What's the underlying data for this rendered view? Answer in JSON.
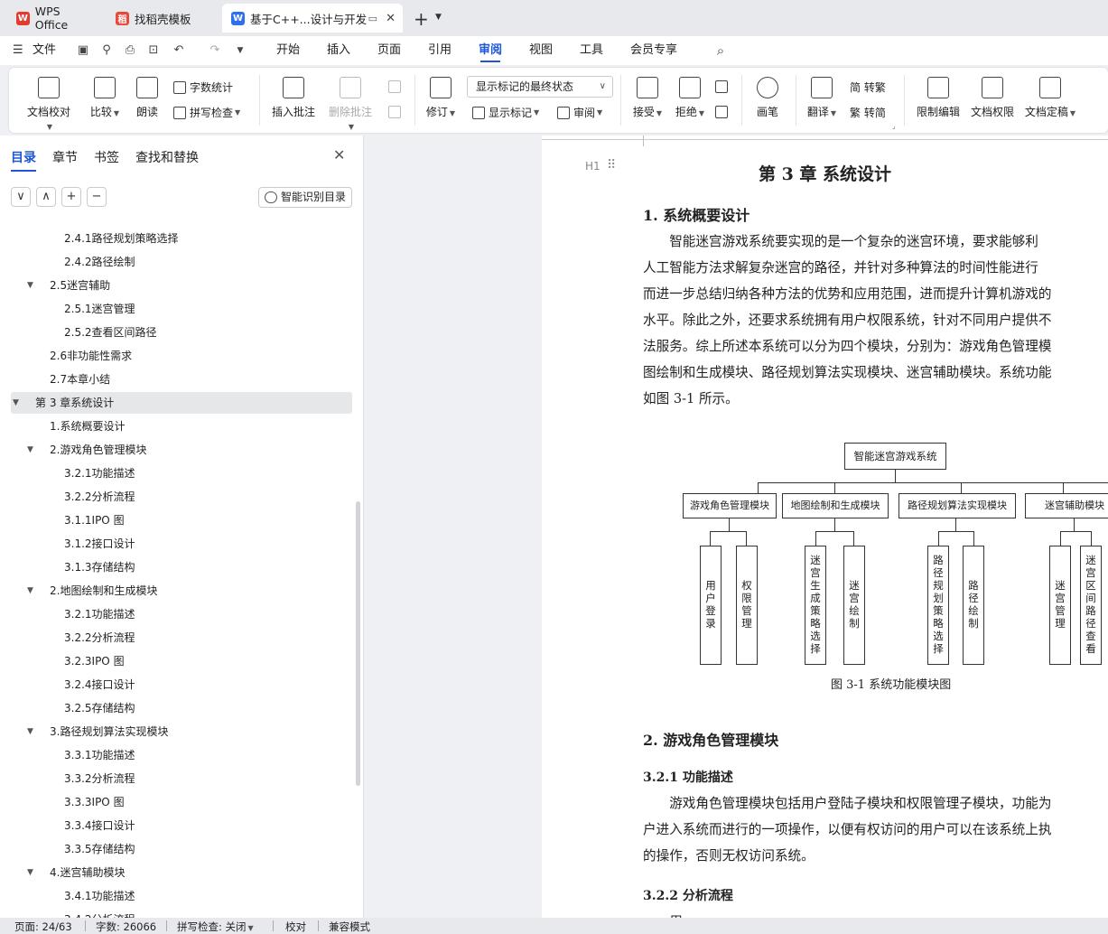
{
  "tabs": [
    {
      "label": "WPS Office",
      "icon": "wps-logo-icon",
      "color": "#e33b2e"
    },
    {
      "label": "找稻壳模板",
      "icon": "docer-icon",
      "color": "#e64a3c"
    },
    {
      "label": "基于C++...设计与开发",
      "icon": "writer-doc-icon",
      "color": "#2f6fed"
    }
  ],
  "new_tab": "+",
  "menu": {
    "file": "文件",
    "items": [
      "开始",
      "插入",
      "页面",
      "引用",
      "审阅",
      "视图",
      "工具",
      "会员专享"
    ],
    "active": "审阅"
  },
  "ribbon": {
    "doc_check": "文档校对",
    "compare": "比较",
    "read_aloud": "朗读",
    "word_count": "字数统计",
    "spell_check": "拼写检查",
    "insert_comment": "插入批注",
    "delete_comment": "删除批注",
    "revise": "修订",
    "markup_select": "显示标记的最终状态",
    "show_markup": "显示标记",
    "review": "审阅",
    "accept": "接受",
    "reject": "拒绝",
    "pen": "画笔",
    "translate": "翻译",
    "to_traditional": "简 转繁",
    "to_simplified": "繁 转简",
    "restrict_edit": "限制编辑",
    "doc_permission": "文档权限",
    "finalize": "文档定稿"
  },
  "panel": {
    "tabs": [
      "目录",
      "章节",
      "书签",
      "查找和替换"
    ],
    "active_tab": "目录",
    "smart_toc": "智能识别目录",
    "toc": [
      {
        "label": "2.4.1路径规划策略选择",
        "level": 3,
        "arrow": ""
      },
      {
        "label": "2.4.2路径绘制",
        "level": 3,
        "arrow": ""
      },
      {
        "label": "2.5迷宫辅助",
        "level": 2,
        "arrow": "▼"
      },
      {
        "label": "2.5.1迷宫管理",
        "level": 3,
        "arrow": ""
      },
      {
        "label": "2.5.2查看区间路径",
        "level": 3,
        "arrow": ""
      },
      {
        "label": "2.6非功能性需求",
        "level": 2,
        "arrow": ""
      },
      {
        "label": "2.7本章小结",
        "level": 2,
        "arrow": ""
      },
      {
        "label": "第 3 章系统设计",
        "level": 1,
        "arrow": "▼",
        "selected": true
      },
      {
        "label": "1.系统概要设计",
        "level": 2,
        "arrow": ""
      },
      {
        "label": "2.游戏角色管理模块",
        "level": 2,
        "arrow": "▼"
      },
      {
        "label": "3.2.1功能描述",
        "level": 3,
        "arrow": ""
      },
      {
        "label": "3.2.2分析流程",
        "level": 3,
        "arrow": ""
      },
      {
        "label": "3.1.1IPO 图",
        "level": 3,
        "arrow": ""
      },
      {
        "label": "3.1.2接口设计",
        "level": 3,
        "arrow": ""
      },
      {
        "label": "3.1.3存储结构",
        "level": 3,
        "arrow": ""
      },
      {
        "label": "2.地图绘制和生成模块",
        "level": 2,
        "arrow": "▼"
      },
      {
        "label": "3.2.1功能描述",
        "level": 3,
        "arrow": ""
      },
      {
        "label": "3.2.2分析流程",
        "level": 3,
        "arrow": ""
      },
      {
        "label": "3.2.3IPO 图",
        "level": 3,
        "arrow": ""
      },
      {
        "label": "3.2.4接口设计",
        "level": 3,
        "arrow": ""
      },
      {
        "label": "3.2.5存储结构",
        "level": 3,
        "arrow": ""
      },
      {
        "label": "3.路径规划算法实现模块",
        "level": 2,
        "arrow": "▼"
      },
      {
        "label": "3.3.1功能描述",
        "level": 3,
        "arrow": ""
      },
      {
        "label": "3.3.2分析流程",
        "level": 3,
        "arrow": ""
      },
      {
        "label": "3.3.3IPO 图",
        "level": 3,
        "arrow": ""
      },
      {
        "label": "3.3.4接口设计",
        "level": 3,
        "arrow": ""
      },
      {
        "label": "3.3.5存储结构",
        "level": 3,
        "arrow": ""
      },
      {
        "label": "4.迷宫辅助模块",
        "level": 2,
        "arrow": "▼"
      },
      {
        "label": "3.4.1功能描述",
        "level": 3,
        "arrow": ""
      },
      {
        "label": "3.4.2分析流程",
        "level": 3,
        "arrow": ""
      }
    ]
  },
  "doc": {
    "heading_marker": "H1",
    "chapter_title": "第 3 章    系统设计",
    "sec1_title": "1.    系统概要设计",
    "sec1_lines": [
      "　　智能迷宫游戏系统要实现的是一个复杂的迷宫环境，要求能够利",
      "人工智能方法求解复杂迷宫的路径，并针对多种算法的时间性能进行",
      "而进一步总结归纳各种方法的优势和应用范围，进而提升计算机游戏的",
      "水平。除此之外，还要求系统拥有用户权限系统，针对不同用户提供不",
      "法服务。综上所述本系统可以分为四个模块，分别为：游戏角色管理模",
      "图绘制和生成模块、路径规划算法实现模块、迷宫辅助模块。系统功能",
      "如图 3-1 所示。"
    ],
    "diagram": {
      "root": "智能迷宫游戏系统",
      "modules": [
        "游戏角色管理模块",
        "地图绘制和生成模块",
        "路径规划算法实现模块",
        "迷宫辅助模块"
      ],
      "leaves": [
        "用户登录",
        "权限管理",
        "迷宫生成策略选择",
        "迷宫绘制",
        "路径规划策略选择",
        "路径绘制",
        "迷宫管理",
        "迷宫区间路径查看"
      ]
    },
    "figure_caption": "图 3-1    系统功能模块图",
    "sec2_title": "2.    游戏角色管理模块",
    "sub1_title": "3.2.1   功能描述",
    "sub1_lines": [
      "　　游戏角色管理模块包括用户登陆子模块和权限管理子模块，功能为",
      "户进入系统而进行的一项操作，以便有权访问的用户可以在该系统上执",
      "的操作，否则无权访问系统。"
    ],
    "sub2_title": "3.2.2   分析流程",
    "sub2_partial": "　　用"
  },
  "status": {
    "page": "页面: 24/63",
    "words": "字数: 26066",
    "spell": "拼写检查: 关闭",
    "proof": "校对",
    "compat": "兼容模式"
  },
  "colors": {
    "accent": "#1f56d6",
    "chrome": "#e7e9ed"
  }
}
